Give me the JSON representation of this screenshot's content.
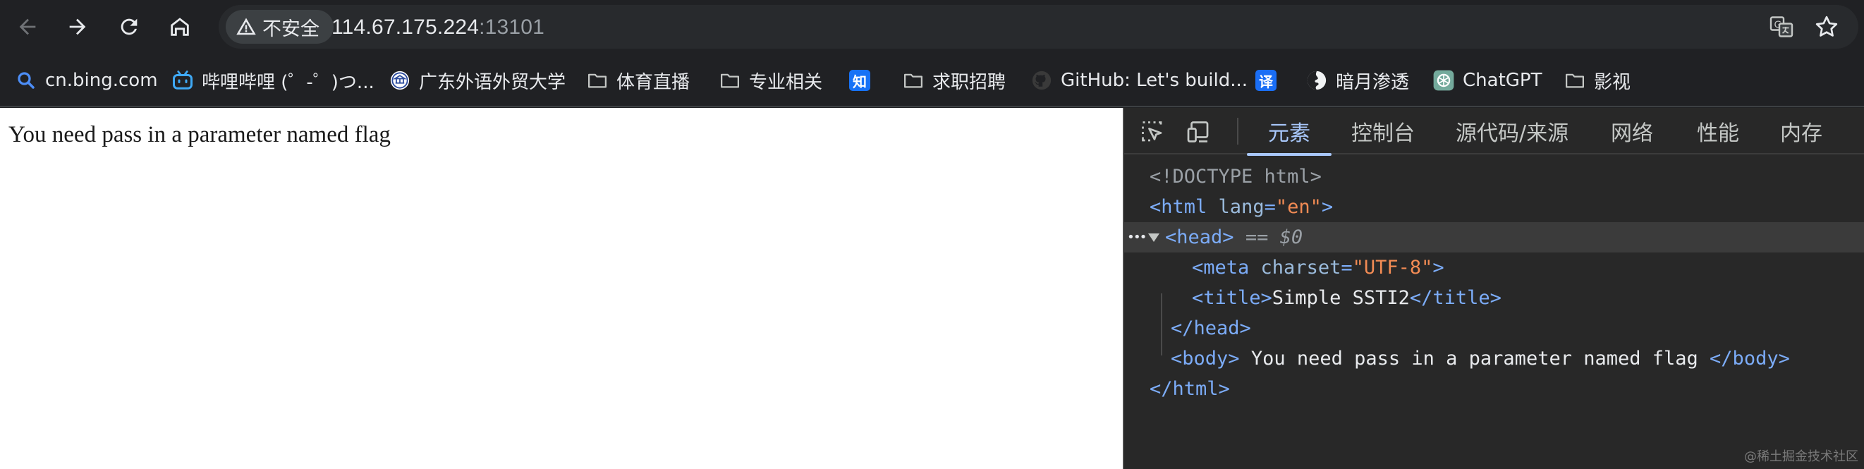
{
  "browser": {
    "security_label": "不安全",
    "url_host": "114.67.175.224",
    "url_port": ":13101"
  },
  "bookmarks": [
    {
      "label": "cn.bing.com",
      "icon": "search-icon"
    },
    {
      "label": "哔哩哔哩 (゜-゜)つ...",
      "icon": "bilibili-icon"
    },
    {
      "label": "广东外语外贸大学",
      "icon": "university-icon"
    },
    {
      "label": "体育直播",
      "icon": "folder-icon"
    },
    {
      "label": "专业相关",
      "icon": "folder-icon"
    },
    {
      "label": "",
      "icon": "zhihu-icon",
      "glyph": "知"
    },
    {
      "label": "求职招聘",
      "icon": "folder-icon"
    },
    {
      "label": "GitHub: Let's build...",
      "icon": "github-icon"
    },
    {
      "label": "",
      "icon": "translate-icon",
      "glyph": "译"
    },
    {
      "label": "暗月渗透",
      "icon": "globe-icon"
    },
    {
      "label": "ChatGPT",
      "icon": "chatgpt-icon"
    },
    {
      "label": "影视",
      "icon": "folder-icon"
    }
  ],
  "page": {
    "body_text": "You need pass in a parameter named flag"
  },
  "devtools": {
    "tabs": [
      "元素",
      "控制台",
      "源代码/来源",
      "网络",
      "性能",
      "内存"
    ],
    "active_tab": "元素",
    "dom": {
      "doctype": "<!DOCTYPE html>",
      "html_open": "<html",
      "html_attr_name": "lang",
      "html_attr_val": "\"en\"",
      "head_open": "<head>",
      "selected_marker": "== $0",
      "meta_open": "<meta",
      "meta_attr_name": "charset",
      "meta_attr_val": "\"UTF-8\"",
      "title_open": "<title>",
      "title_text": "Simple SSTI2",
      "title_close": "</title>",
      "head_close": "</head>",
      "body_open": "<body>",
      "body_text": "You need pass in a parameter named flag",
      "body_close": "</body>",
      "html_close": "</html>",
      "ellipsis": "•••"
    },
    "watermark": "@稀土掘金技术社区"
  },
  "colors": {
    "accent": "#a8c7fa",
    "tag": "#7cacf8",
    "attr_value": "#f28b54"
  }
}
